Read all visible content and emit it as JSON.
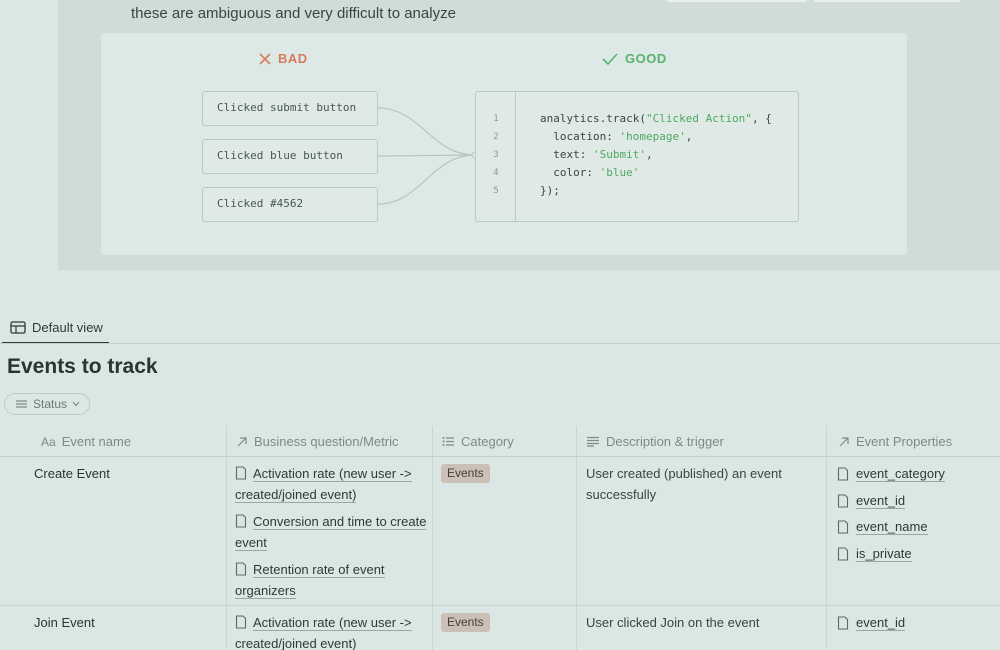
{
  "callout": {
    "text": "these are ambiguous and very difficult to analyze"
  },
  "illustration": {
    "bad_label": "BAD",
    "good_label": "GOOD",
    "bad_examples": [
      "Clicked submit button",
      "Clicked blue button",
      "Clicked #4562"
    ],
    "code_line_numbers": [
      "1",
      "2",
      "3",
      "4",
      "5"
    ],
    "code": {
      "l1_pre": "analytics.track(",
      "l1_str": "\"Clicked Action\"",
      "l1_post": ", {",
      "l2_key": "  location: ",
      "l2_str": "'homepage'",
      "l2_post": ",",
      "l3_key": "  text: ",
      "l3_str": "'Submit'",
      "l3_post": ",",
      "l4_key": "  color: ",
      "l4_str": "'blue'",
      "l5": "});"
    },
    "colors": {
      "bad": "#d87a5a",
      "good": "#58b36c"
    }
  },
  "view": {
    "tab_label": "Default view",
    "tab_icon": "table-view-icon"
  },
  "database": {
    "title": "Events to track",
    "filter_label": "Status"
  },
  "table": {
    "columns": [
      {
        "label": "Event name",
        "icon": "Aa"
      },
      {
        "label": "Business question/Metric",
        "icon": "relation-arrow-icon"
      },
      {
        "label": "Category",
        "icon": "list-icon"
      },
      {
        "label": "Description & trigger",
        "icon": "text-lines-icon"
      },
      {
        "label": "Event Properties",
        "icon": "relation-arrow-icon"
      }
    ],
    "rows": [
      {
        "name": "Create Event",
        "metrics": [
          "Activation rate (new user -> created/joined event)",
          "Conversion and time to create event",
          "Retention rate of event organizers"
        ],
        "category": "Events",
        "description": "User created (published) an event successfully",
        "properties": [
          "event_category",
          "event_id",
          "event_name",
          "is_private"
        ]
      },
      {
        "name": "Join Event",
        "metrics": [
          "Activation rate (new user -> created/joined event)"
        ],
        "category": "Events",
        "description": "User clicked Join on the event",
        "properties": [
          "event_id"
        ]
      }
    ]
  }
}
